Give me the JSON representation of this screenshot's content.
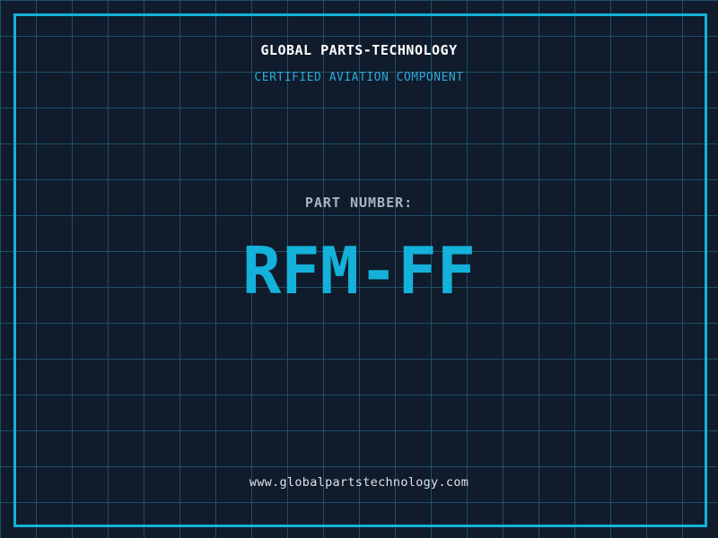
{
  "header": {
    "title": "GLOBAL PARTS-TECHNOLOGY",
    "subtitle": "CERTIFIED AVIATION COMPONENT"
  },
  "part": {
    "label": "PART NUMBER:",
    "number": "RFM-FF"
  },
  "footer": {
    "url": "www.globalpartstechnology.com"
  },
  "colors": {
    "background": "#101b2c",
    "grid_line": "#1e4f68",
    "frame": "#14b1da",
    "title_text": "#ffffff",
    "subtitle_text": "#2fa9d8",
    "label_text": "#a9b2bf",
    "part_number_text": "#14b1da",
    "footer_text": "#dde2e6"
  }
}
